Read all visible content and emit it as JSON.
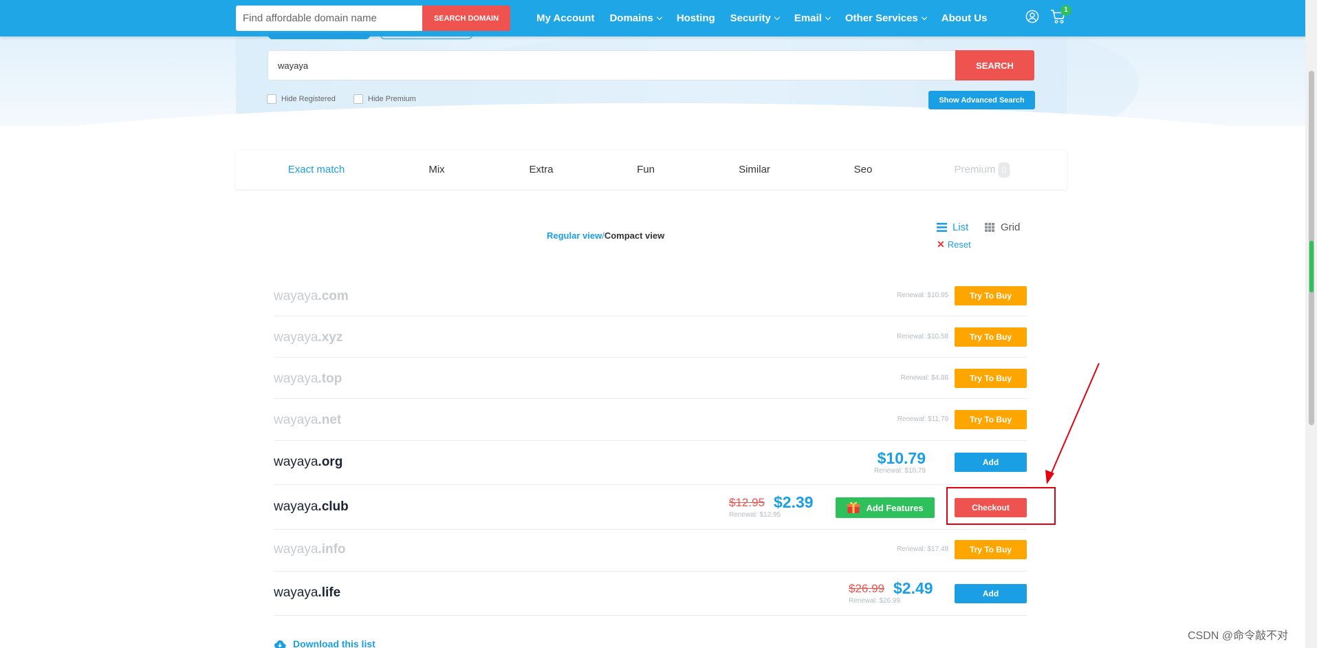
{
  "nav": {
    "search_placeholder": "Find affordable domain name",
    "search_button": "SEARCH DOMAIN",
    "menu": [
      {
        "label": "My Account",
        "dropdown": false
      },
      {
        "label": "Domains",
        "dropdown": true
      },
      {
        "label": "Hosting",
        "dropdown": false
      },
      {
        "label": "Security",
        "dropdown": true
      },
      {
        "label": "Email",
        "dropdown": true
      },
      {
        "label": "Other Services",
        "dropdown": true
      },
      {
        "label": "About Us",
        "dropdown": false
      }
    ],
    "cart_count": "1",
    "icons": {
      "user": "user-icon",
      "cart": "cart-icon"
    }
  },
  "search": {
    "value": "wayaya",
    "button": "SEARCH",
    "hide_registered": "Hide Registered",
    "hide_premium": "Hide Premium",
    "advanced_button": "Show Advanced Search"
  },
  "tabs": [
    {
      "label": "Exact match",
      "state": "active"
    },
    {
      "label": "Mix",
      "state": "normal"
    },
    {
      "label": "Extra",
      "state": "normal"
    },
    {
      "label": "Fun",
      "state": "normal"
    },
    {
      "label": "Similar",
      "state": "normal"
    },
    {
      "label": "Seo",
      "state": "normal"
    },
    {
      "label": "Premium",
      "state": "muted",
      "count": "0"
    }
  ],
  "view": {
    "regular": "Regular view",
    "separator": "/",
    "compact": "Compact view",
    "list": "List",
    "grid": "Grid",
    "reset": "Reset"
  },
  "domains": [
    {
      "name": "wayaya",
      "tld": ".com",
      "status": "taken",
      "renewal": "Renewal: $10.95",
      "action": "Try To Buy"
    },
    {
      "name": "wayaya",
      "tld": ".xyz",
      "status": "taken",
      "renewal": "Renewal: $10.58",
      "action": "Try To Buy"
    },
    {
      "name": "wayaya",
      "tld": ".top",
      "status": "taken",
      "renewal": "Renewal: $4.88",
      "action": "Try To Buy"
    },
    {
      "name": "wayaya",
      "tld": ".net",
      "status": "taken",
      "renewal": "Renewal: $11.79",
      "action": "Try To Buy"
    },
    {
      "name": "wayaya",
      "tld": ".org",
      "status": "available",
      "price": "$10.79",
      "renewal": "Renewal: $10.79",
      "action": "Add"
    },
    {
      "name": "wayaya",
      "tld": ".club",
      "status": "in-cart",
      "old_price": "$12.95",
      "price": "$2.39",
      "renewal": "Renewal: $12.95",
      "features": "Add Features",
      "action": "Checkout"
    },
    {
      "name": "wayaya",
      "tld": ".info",
      "status": "taken",
      "renewal": "Renewal: $17.49",
      "action": "Try To Buy"
    },
    {
      "name": "wayaya",
      "tld": ".life",
      "status": "sale",
      "old_price": "$26.99",
      "price": "$2.49",
      "renewal": "Renewal: $26.99",
      "action": "Add"
    }
  ],
  "download": "Download this list",
  "watermark": "CSDN @命令敲不对",
  "colors": {
    "brand_blue": "#1fa6e6",
    "accent_red": "#ef5350",
    "try_orange": "#ffa500",
    "success_green": "#2ec05a",
    "annotation_red": "#e3000f"
  }
}
